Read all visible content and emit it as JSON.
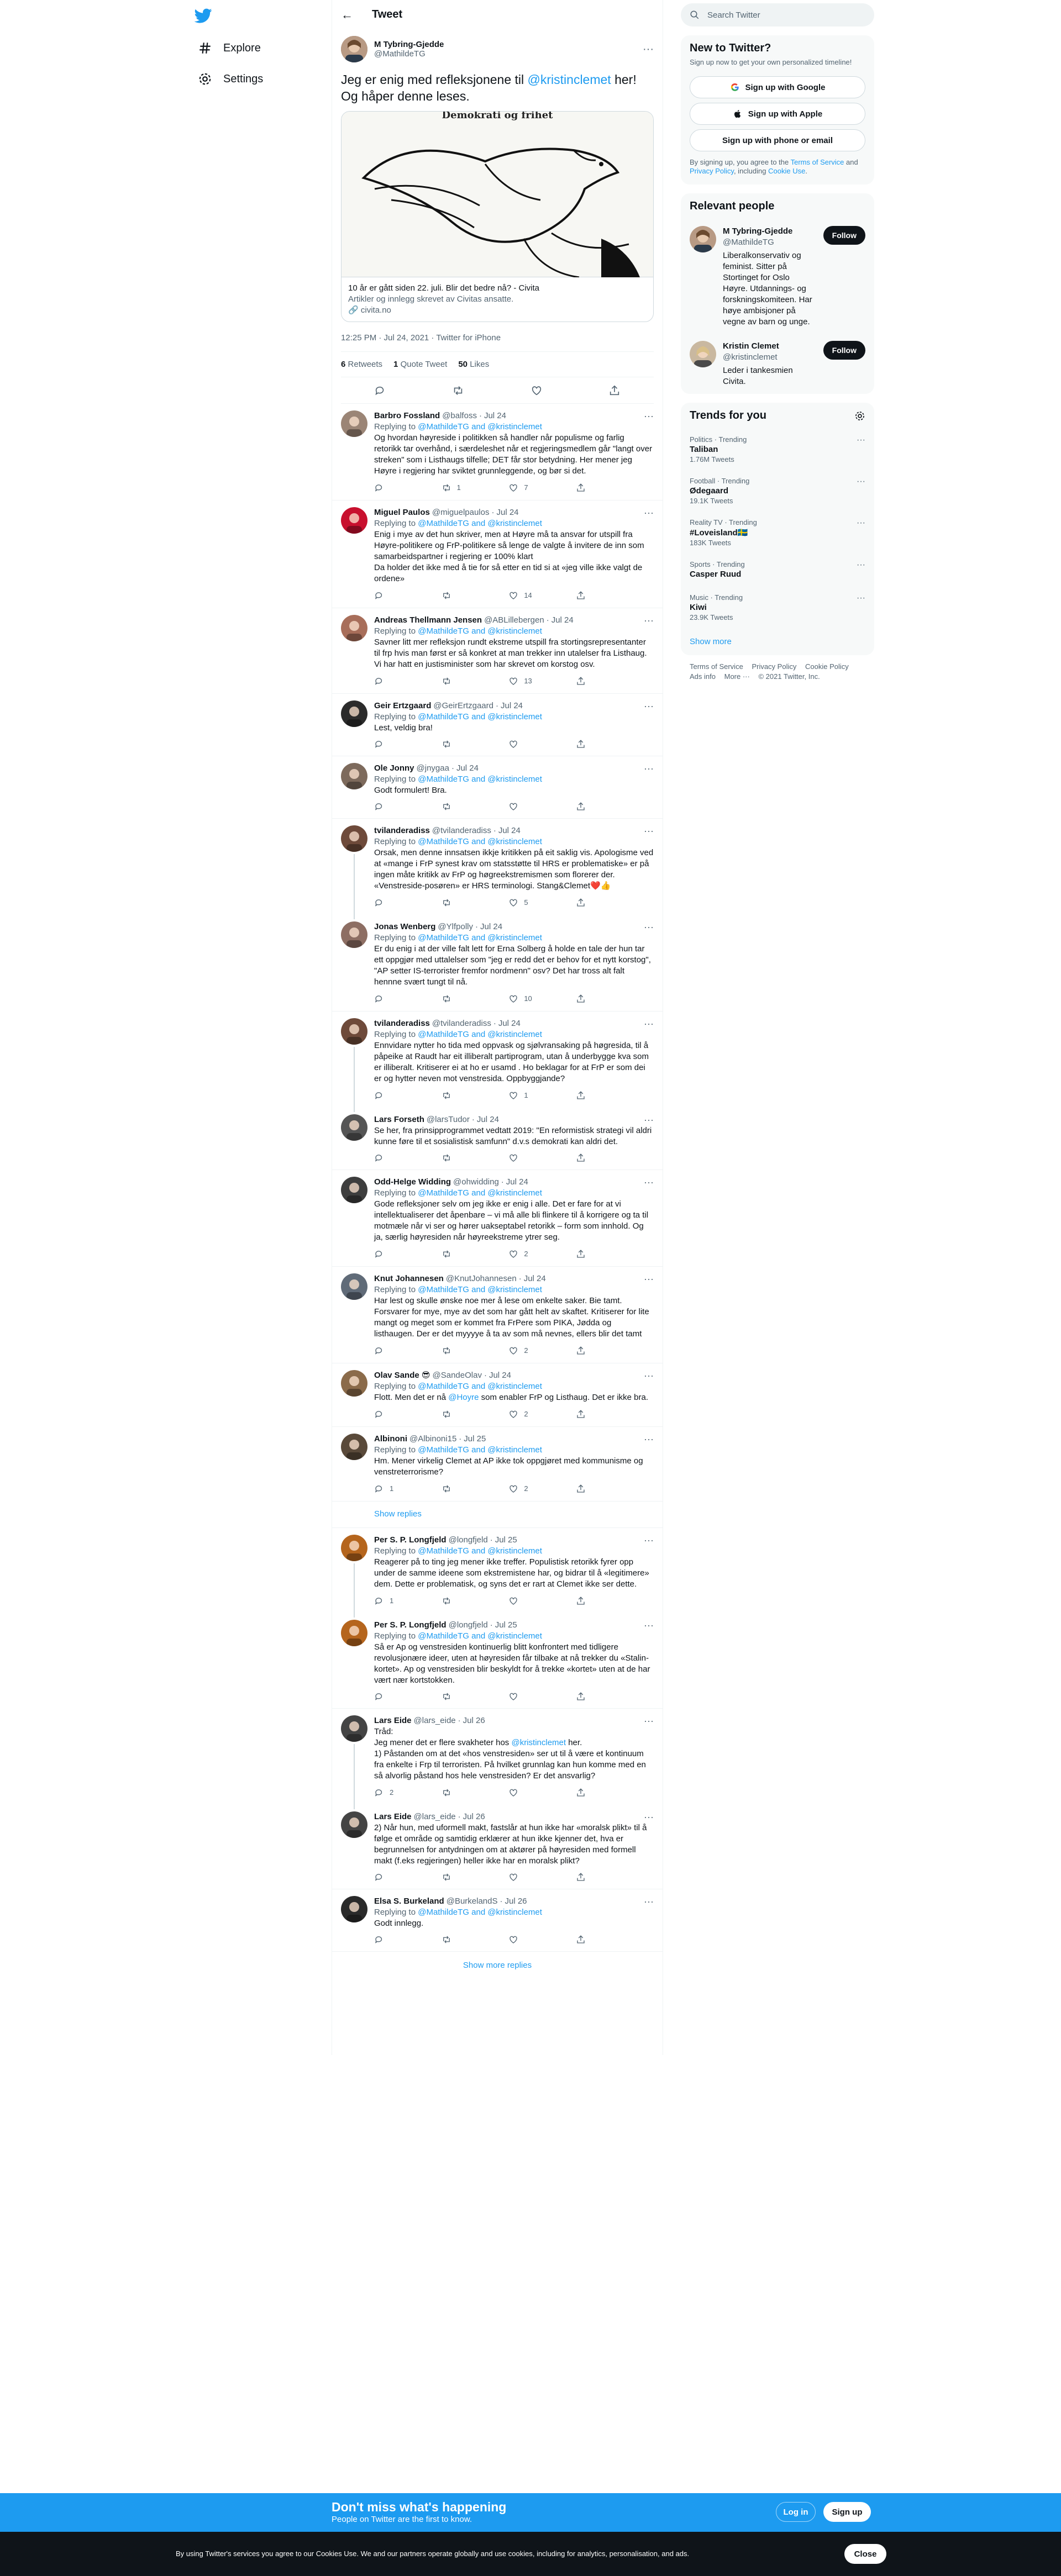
{
  "nav": {
    "items": [
      {
        "label": "Explore",
        "icon": "hashtag-icon"
      },
      {
        "label": "Settings",
        "icon": "gear-icon"
      }
    ]
  },
  "header": {
    "title": "Tweet"
  },
  "tweet": {
    "name": "M Tybring-Gjedde",
    "handle": "@MathildeTG",
    "text_pre": "Jeg er enig med refleksjonene til ",
    "mention": "@kristinclemet",
    "text_post": " her! Og håper denne leses.",
    "card": {
      "title": "10 år er gått siden 22. juli. Blir det bedre nå? - Civita",
      "desc": "Artikler og innlegg skrevet av Civitas ansatte.",
      "domain": "civita.no",
      "image_caption": "Demokrati og frihet"
    },
    "time": "12:25 PM · Jul 24, 2021 · Twitter for iPhone",
    "retweets": "6",
    "retweets_label": "Retweets",
    "quotes": "1",
    "quotes_label": "Quote Tweet",
    "likes": "50",
    "likes_label": "Likes"
  },
  "replies": [
    {
      "name": "Barbro Fossland",
      "handle": "@balfoss",
      "date": "Jul 24",
      "replying": "Replying to ",
      "to": "@MathildeTG and @kristinclemet",
      "text": "Og hvordan høyreside i politikken så handler når populisme og farlig retorikk tar overhånd, i særdeleshet når et regjeringsmedlem går \"langt over streken\" som i Listhaugs tilfelle; DET får stor betydning. Her mener jeg Høyre i regjering har sviktet grunnleggende, og bør si det.",
      "replies": "",
      "rts": "1",
      "likes": "7",
      "color": "#9b8576"
    },
    {
      "name": "Miguel Paulos",
      "handle": "@miguelpaulos",
      "date": "Jul 24",
      "replying": "Replying to ",
      "to": "@MathildeTG and @kristinclemet",
      "text": "Enig i mye av det hun skriver, men at Høyre må ta ansvar for utspill fra Høyre-politikere og FrP-politikere så lenge de valgte å invitere de inn som samarbeidspartner i regjering er 100% klart\nDa holder det ikke med å tie for så etter en tid si at «jeg ville ikke valgt de ordene»",
      "replies": "",
      "rts": "",
      "likes": "14",
      "color": "#c8102e"
    },
    {
      "name": "Andreas Thellmann Jensen",
      "handle": "@ABLillebergen",
      "date": "Jul 24",
      "replying": "Replying to ",
      "to": "@MathildeTG and @kristinclemet",
      "text": "Savner litt mer refleksjon rundt ekstreme utspill fra stortingsrepresentanter til frp hvis man først er så konkret at man trekker inn utalelser fra Listhaug. Vi har hatt en justisminister som har skrevet om korstog osv.",
      "replies": "",
      "rts": "",
      "likes": "13",
      "color": "#a86e5a"
    },
    {
      "name": "Geir Ertzgaard",
      "handle": "@GeirErtzgaard",
      "date": "Jul 24",
      "replying": "Replying to ",
      "to": "@MathildeTG and @kristinclemet",
      "text": "Lest, veldig bra!",
      "replies": "",
      "rts": "",
      "likes": "",
      "color": "#2b2b2b"
    },
    {
      "name": "Ole Jonny",
      "handle": "@jnygaa",
      "date": "Jul 24",
      "replying": "Replying to ",
      "to": "@MathildeTG and @kristinclemet",
      "text": "Godt formulert!  Bra.",
      "replies": "",
      "rts": "",
      "likes": "",
      "color": "#7d6a5c"
    },
    {
      "name": "tvilanderadiss",
      "handle": "@tvilanderadiss",
      "date": "Jul 24",
      "replying": "Replying to ",
      "to": "@MathildeTG and @kristinclemet",
      "text": "Orsak, men denne innsatsen ikkje kritikken på eit saklig vis. Apologisme ved at «mange i FrP synest krav om statsstøtte til HRS er problematiske» er på ingen måte kritikk av FrP og høgreekstremismen som florerer der. «Venstreside-posøren» er HRS terminologi. Stang&Clemet❤️👍",
      "replies": "",
      "rts": "",
      "likes": "5",
      "color": "#6e4a3a"
    },
    {
      "name": "Jonas Wenberg",
      "handle": "@Ylfpolly",
      "date": "Jul 24",
      "replying": "Replying to ",
      "to": "@MathildeTG and @kristinclemet",
      "text": "Er du enig i at der ville falt lett for Erna Solberg å holde en tale der hun tar ett oppgjør med uttalelser som \"jeg er redd det er behov for et nytt korstog\", \"AP setter IS-terrorister fremfor nordmenn\" osv? Det har tross alt falt hennne svært tungt til nå.",
      "replies": "",
      "rts": "",
      "likes": "10",
      "color": "#8d6e63"
    },
    {
      "name": "tvilanderadiss",
      "handle": "@tvilanderadiss",
      "date": "Jul 24",
      "replying": "Replying to ",
      "to": "@MathildeTG and @kristinclemet",
      "text": "Ennvidare nytter ho tida med oppvask og sjølvransaking på høgresida, til å påpeike at Raudt har eit illiberalt partiprogram, utan å underbygge kva som er illiberalt. Kritiserer ei at ho er usamd . Ho beklagar for at FrP er som dei er og hytter neven mot venstresida. Oppbyggjande?",
      "replies": "",
      "rts": "",
      "likes": "1",
      "color": "#6e4a3a"
    },
    {
      "name": "Lars Forseth",
      "handle": "@larsTudor",
      "date": "Jul 24",
      "replying": "",
      "to": "",
      "text": "Se her, fra prinsipprogrammet vedtatt 2019: \"En reformistisk strategi vil aldri kunne føre til et sosialistisk samfunn\" d.v.s demokrati kan aldri det.",
      "replies": "",
      "rts": "",
      "likes": "",
      "color": "#555555"
    },
    {
      "name": "Odd-Helge Widding",
      "handle": "@ohwidding",
      "date": "Jul 24",
      "replying": "Replying to ",
      "to": "@MathildeTG and @kristinclemet",
      "text": "Gode refleksjoner selv om jeg ikke er enig i alle. Det er fare for at vi intellektualiserer det åpenbare – vi må alle bli flinkere til å korrigere og ta til motmæle når vi ser og hører uakseptabel retorikk – form som innhold. Og ja, særlig høyresiden når høyreekstreme ytrer seg.",
      "replies": "",
      "rts": "",
      "likes": "2",
      "color": "#3e3e3e"
    },
    {
      "name": "Knut Johannesen",
      "handle": "@KnutJohannesen",
      "date": "Jul 24",
      "replying": "Replying to ",
      "to": "@MathildeTG and @kristinclemet",
      "text": "Har lest og skulle ønske  noe mer å lese om enkelte saker. Bie tamt. Forsvarer for mye, mye av det som har gått helt av skaftet. Kritiserer for lite mangt og meget som er kommet fra FrPere som PIKA, Jødda og listhaugen. Der er det myyyye å ta av som må nevnes, ellers blir det tamt",
      "replies": "",
      "rts": "",
      "likes": "2",
      "color": "#606b78"
    },
    {
      "name": "Olav Sande 😎",
      "handle": "@SandeOlav",
      "date": "Jul 24",
      "replying": "Replying to ",
      "to": "@MathildeTG and @kristinclemet",
      "text_pre": "Flott. Men det er nå ",
      "text_mention": "@Hoyre",
      "text_post": " som enabler FrP og Listhaug. Det er ikke bra.",
      "text": "",
      "replies": "",
      "rts": "",
      "likes": "2",
      "color": "#8b6b4a"
    },
    {
      "name": "Albinoni",
      "handle": "@Albinoni15",
      "date": "Jul 25",
      "replying": "Replying to ",
      "to": "@MathildeTG and @kristinclemet",
      "text": "Hm. Mener virkelig Clemet at AP ikke tok oppgjøret med kommunisme og venstreterrorisme?",
      "replies": "1",
      "rts": "",
      "likes": "2",
      "color": "#5a4a3a"
    },
    {
      "name": "Per S. P. Longfjeld",
      "handle": "@longfjeld",
      "date": "Jul 25",
      "replying": "Replying to ",
      "to": "@MathildeTG and @kristinclemet",
      "text": "Reagerer på to ting jeg mener ikke treffer. Populistisk retorikk fyrer opp under de samme ideene som ekstremistene har, og bidrar til å «legitimere» dem. Dette er problematisk, og syns det er rart at Clemet ikke ser dette.",
      "replies": "1",
      "rts": "",
      "likes": "",
      "color": "#b5651d"
    },
    {
      "name": "Per S. P. Longfjeld",
      "handle": "@longfjeld",
      "date": "Jul 25",
      "replying": "Replying to ",
      "to": "@MathildeTG and @kristinclemet",
      "text": "Så er Ap og venstresiden kontinuerlig blitt konfrontert med tidligere revolusjonære ideer, uten at høyresiden får tilbake at nå trekker du «Stalin-kortet». Ap og venstresiden blir beskyldt for å trekke «kortet» uten at de har vært nær kortstokken.",
      "replies": "",
      "rts": "",
      "likes": "",
      "color": "#b5651d"
    },
    {
      "name": "Lars Eide",
      "handle": "@lars_eide",
      "date": "Jul 26",
      "replying": "",
      "to": "",
      "text_pre": "Tråd:\nJeg mener det er flere svakheter hos ",
      "text_mention": "@kristinclemet",
      "text_post": " her.\n1) Påstanden om at det «hos venstresiden» ser ut til å være et kontinuum fra enkelte i Frp til terroristen. På hvilket grunnlag kan hun komme med en så alvorlig påstand hos hele venstresiden? Er det ansvarlig?",
      "text": "",
      "replies": "2",
      "rts": "",
      "likes": "",
      "color": "#444444"
    },
    {
      "name": "Lars Eide",
      "handle": "@lars_eide",
      "date": "Jul 26",
      "replying": "",
      "to": "",
      "text": "2) Når hun, med uformell makt, fastslår at hun ikke har «moralsk plikt» til å følge et område og samtidig erklærer at hun ikke kjenner det, hva er begrunnelsen for antydningen om at aktører på høyresiden med formell makt (f.eks regjeringen) heller ikke har en moralsk plikt?",
      "replies": "",
      "rts": "",
      "likes": "",
      "color": "#444444"
    },
    {
      "name": "Elsa S. Burkeland",
      "handle": "@BurkelandS",
      "date": "Jul 26",
      "replying": "Replying to ",
      "to": "@MathildeTG and @kristinclemet",
      "text": "Godt innlegg.",
      "replies": "",
      "rts": "",
      "likes": "",
      "color": "#2a2a2a"
    }
  ],
  "show_replies": "Show replies",
  "show_more_replies": "Show more replies",
  "sidebar": {
    "search_placeholder": "Search Twitter",
    "new_title": "New to Twitter?",
    "new_sub": "Sign up now to get your own personalized timeline!",
    "btn_google": "Sign up with Google",
    "btn_apple": "Sign up with Apple",
    "btn_phone": "Sign up with phone or email",
    "legal_pre": "By signing up, you agree to the ",
    "legal_tos": "Terms of Service",
    "legal_mid": " and ",
    "legal_pp": "Privacy Policy",
    "legal_mid2": ", including ",
    "legal_cookie": "Cookie Use",
    "legal_end": ".",
    "relevant_title": "Relevant people",
    "people": [
      {
        "name": "M Tybring-Gjedde",
        "handle": "@MathildeTG",
        "bio": "Liberalkonservativ og feminist. Sitter på Stortinget for Oslo Høyre. Utdannings- og forskningskomiteen. Har høye ambisjoner på vegne av barn og unge.",
        "follow": "Follow"
      },
      {
        "name": "Kristin Clemet",
        "handle": "@kristinclemet",
        "bio": "Leder i tankesmien Civita.",
        "follow": "Follow"
      }
    ],
    "trends_title": "Trends for you",
    "trends": [
      {
        "cat": "Politics · Trending",
        "name": "Taliban",
        "count": "1.76M Tweets"
      },
      {
        "cat": "Football · Trending",
        "name": "Ødegaard",
        "count": "19.1K Tweets"
      },
      {
        "cat": "Reality TV · Trending",
        "name": "#Loveisland🇸🇪",
        "count": "183K Tweets"
      },
      {
        "cat": "Sports · Trending",
        "name": "Casper Ruud",
        "count": ""
      },
      {
        "cat": "Music · Trending",
        "name": "Kiwi",
        "count": "23.9K Tweets"
      }
    ],
    "show_more": "Show more",
    "footer": [
      "Terms of Service",
      "Privacy Policy",
      "Cookie Policy",
      "Ads info",
      "More ···",
      "© 2021 Twitter, Inc."
    ]
  },
  "signup_bar": {
    "title": "Don't miss what's happening",
    "sub": "People on Twitter are the first to know.",
    "login": "Log in",
    "signup": "Sign up"
  },
  "cookie_bar": {
    "text": "By using Twitter's services you agree to our Cookies Use. We and our partners operate globally and use cookies, including for analytics, personalisation, and ads.",
    "close": "Close"
  },
  "colors": {
    "accent": "#1d9bf0",
    "text": "#0f1419",
    "muted": "#536471"
  }
}
